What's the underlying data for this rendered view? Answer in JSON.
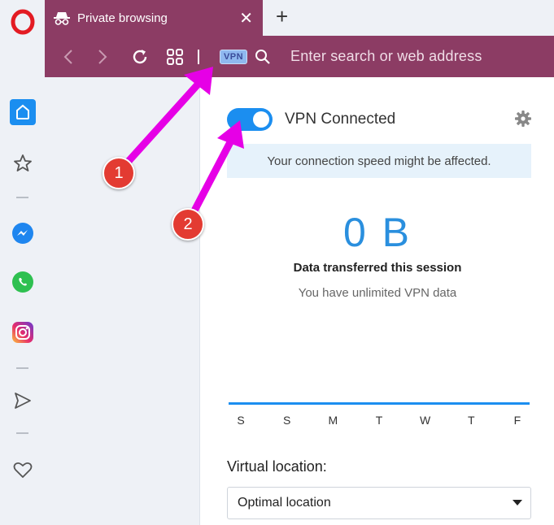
{
  "tab": {
    "label": "Private browsing"
  },
  "toolbar": {
    "vpn_badge": "VPN",
    "address_placeholder": "Enter search or web address"
  },
  "vpn": {
    "status": "VPN Connected",
    "notice": "Your connection speed might be affected.",
    "transferred": "0 B",
    "transferred_label": "Data transferred this session",
    "data_note": "You have unlimited VPN data",
    "days": [
      "S",
      "S",
      "M",
      "T",
      "W",
      "T",
      "F"
    ],
    "location_label": "Virtual location:",
    "location_value": "Optimal location",
    "connected": true
  },
  "annotations": {
    "label_1": "1",
    "label_2": "2",
    "arrow_color": "#e600e6"
  },
  "colors": {
    "theme": "#8c3c64",
    "accent": "#1b8ef0",
    "number": "#2a8fde",
    "badge": "#e33b32"
  },
  "sidebar": {
    "icons": [
      "opera-logo-icon",
      "home-icon",
      "star-icon",
      "messenger-icon",
      "whatsapp-icon",
      "instagram-icon",
      "send-icon",
      "heart-icon"
    ]
  }
}
